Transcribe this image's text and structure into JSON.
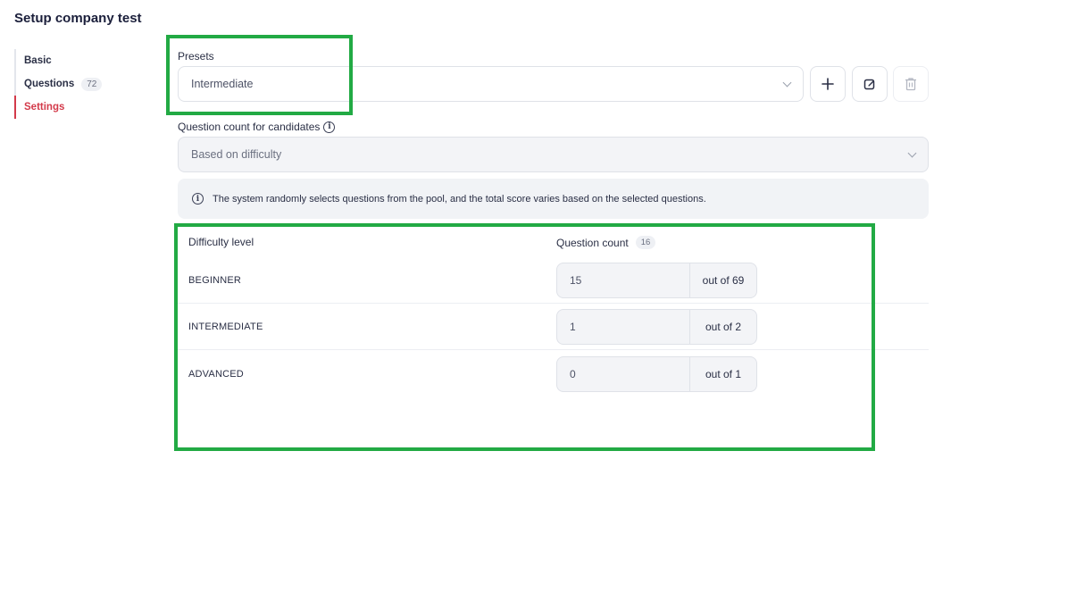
{
  "page": {
    "title": "Setup company test"
  },
  "sidebar": {
    "items": [
      {
        "label": "Basic"
      },
      {
        "label": "Questions",
        "badge": "72"
      },
      {
        "label": "Settings",
        "active": true
      }
    ]
  },
  "presets": {
    "label": "Presets",
    "selected": "Intermediate",
    "icons": [
      "plus-icon",
      "edit-icon",
      "trash-icon"
    ]
  },
  "question_count": {
    "label": "Question count for candidates",
    "selected": "Based on difficulty"
  },
  "notice": {
    "text": "The system randomly selects questions from the pool, and the total score varies based on the selected questions."
  },
  "table": {
    "headers": {
      "difficulty": "Difficulty level",
      "count": "Question count",
      "count_badge": "16"
    },
    "rows": [
      {
        "level": "BEGINNER",
        "value": "15",
        "suffix": "out of 69"
      },
      {
        "level": "INTERMEDIATE",
        "value": "1",
        "suffix": "out of 2"
      },
      {
        "level": "ADVANCED",
        "value": "0",
        "suffix": "out of 1"
      }
    ]
  },
  "colors": {
    "accent": "#d33a4a",
    "highlight": "#22aa44"
  }
}
